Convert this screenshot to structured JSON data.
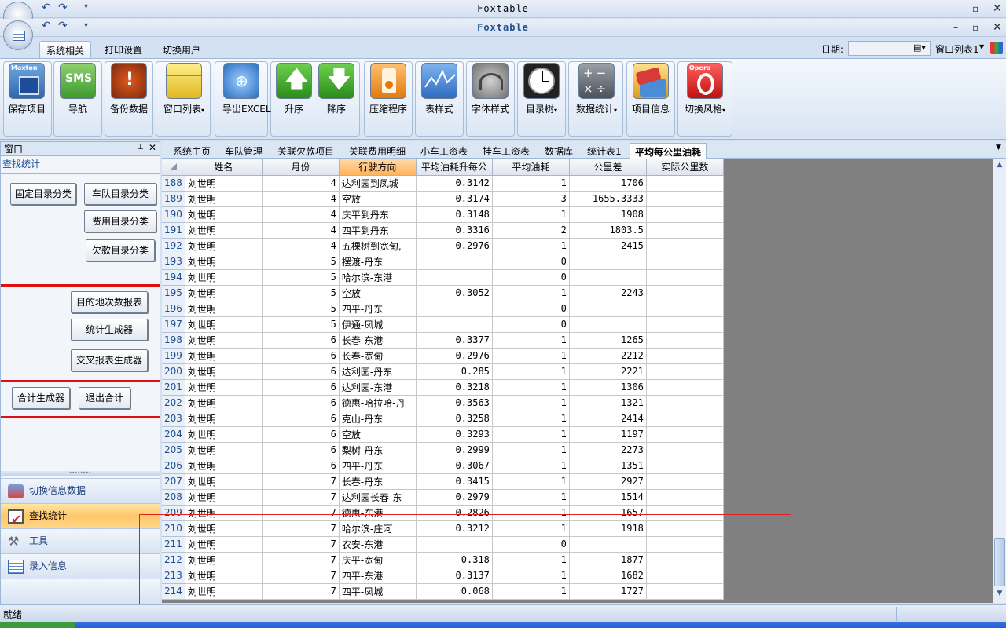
{
  "window": {
    "title": "Foxtable",
    "title2": "Foxtable"
  },
  "ribbon_tabs": [
    "系统相关",
    "打印设置",
    "切换用户"
  ],
  "date": {
    "label": "日期:",
    "value": ""
  },
  "window_list": "窗口列表1",
  "ribbon_buttons": [
    {
      "label": "保存项目",
      "icon": "save-icon"
    },
    {
      "label": "导航",
      "icon": "sms-icon"
    },
    {
      "label": "备份数据",
      "icon": "backup-icon"
    },
    {
      "label": "窗口列表",
      "icon": "window-list-icon",
      "dropdown": true
    },
    {
      "label": "导出EXCEL",
      "icon": "export-icon"
    },
    {
      "label": "升序",
      "icon": "arrow-up-icon"
    },
    {
      "label": "降序",
      "icon": "arrow-down-icon"
    },
    {
      "label": "压缩程序",
      "icon": "compress-icon"
    },
    {
      "label": "表样式",
      "icon": "chart-style-icon"
    },
    {
      "label": "字体样式",
      "icon": "font-style-icon"
    },
    {
      "label": "目录树",
      "icon": "clock-icon",
      "dropdown": true
    },
    {
      "label": "数据统计",
      "icon": "calculator-icon",
      "dropdown": true
    },
    {
      "label": "项目信息",
      "icon": "card-icon"
    },
    {
      "label": "切换风格",
      "icon": "opera-icon",
      "dropdown": true
    }
  ],
  "left_pane": {
    "title": "窗口",
    "subtitle": "查找统计",
    "buttons": [
      "固定目录分类",
      "车队目录分类",
      "费用目录分类",
      "欠款目录分类",
      "目的地次数报表",
      "统计生成器",
      "交叉报表生成器",
      "合计生成器",
      "退出合计"
    ],
    "nav": [
      "切换信息数据",
      "查找统计",
      "工具",
      "录入信息"
    ]
  },
  "doc_tabs": [
    "系统主页",
    "车队管理",
    "关联欠款项目",
    "关联费用明细",
    "小车工资表",
    "挂车工资表",
    "数据库",
    "统计表1",
    "平均每公里油耗"
  ],
  "columns": [
    "姓名",
    "月份",
    "行驶方向",
    "平均油耗升每公",
    "平均油耗",
    "公里差",
    "实际公里数"
  ],
  "rows": [
    [
      "188",
      "刘世明",
      "4",
      "达利园到凤城",
      "0.3142",
      "1",
      "1706",
      ""
    ],
    [
      "189",
      "刘世明",
      "4",
      "空放",
      "0.3174",
      "3",
      "1655.3333",
      ""
    ],
    [
      "190",
      "刘世明",
      "4",
      "庆平到丹东",
      "0.3148",
      "1",
      "1908",
      ""
    ],
    [
      "191",
      "刘世明",
      "4",
      "四平到丹东",
      "0.3316",
      "2",
      "1803.5",
      ""
    ],
    [
      "192",
      "刘世明",
      "4",
      "五棵树到宽甸,",
      "0.2976",
      "1",
      "2415",
      ""
    ],
    [
      "193",
      "刘世明",
      "5",
      "摆渡-丹东",
      "",
      "0",
      "",
      ""
    ],
    [
      "194",
      "刘世明",
      "5",
      "哈尔滨-东港",
      "",
      "0",
      "",
      ""
    ],
    [
      "195",
      "刘世明",
      "5",
      "空放",
      "0.3052",
      "1",
      "2243",
      ""
    ],
    [
      "196",
      "刘世明",
      "5",
      "四平-丹东",
      "",
      "0",
      "",
      ""
    ],
    [
      "197",
      "刘世明",
      "5",
      "伊通-凤城",
      "",
      "0",
      "",
      ""
    ],
    [
      "198",
      "刘世明",
      "6",
      "长春-东港",
      "0.3377",
      "1",
      "1265",
      ""
    ],
    [
      "199",
      "刘世明",
      "6",
      "长春-宽甸",
      "0.2976",
      "1",
      "2212",
      ""
    ],
    [
      "200",
      "刘世明",
      "6",
      "达利园-丹东",
      "0.285",
      "1",
      "2221",
      ""
    ],
    [
      "201",
      "刘世明",
      "6",
      "达利园-东港",
      "0.3218",
      "1",
      "1306",
      ""
    ],
    [
      "202",
      "刘世明",
      "6",
      "德惠-哈拉哈-丹",
      "0.3563",
      "1",
      "1321",
      ""
    ],
    [
      "203",
      "刘世明",
      "6",
      "克山-丹东",
      "0.3258",
      "1",
      "2414",
      ""
    ],
    [
      "204",
      "刘世明",
      "6",
      "空放",
      "0.3293",
      "1",
      "1197",
      ""
    ],
    [
      "205",
      "刘世明",
      "6",
      "梨树-丹东",
      "0.2999",
      "1",
      "2273",
      ""
    ],
    [
      "206",
      "刘世明",
      "6",
      "四平-丹东",
      "0.3067",
      "1",
      "1351",
      ""
    ],
    [
      "207",
      "刘世明",
      "7",
      "长春-丹东",
      "0.3415",
      "1",
      "2927",
      ""
    ],
    [
      "208",
      "刘世明",
      "7",
      "达利园长春-东",
      "0.2979",
      "1",
      "1514",
      ""
    ],
    [
      "209",
      "刘世明",
      "7",
      "德惠-东港",
      "0.2826",
      "1",
      "1657",
      ""
    ],
    [
      "210",
      "刘世明",
      "7",
      "哈尔滨-庄河",
      "0.3212",
      "1",
      "1918",
      ""
    ],
    [
      "211",
      "刘世明",
      "7",
      "农安-东港",
      "",
      "0",
      "",
      ""
    ],
    [
      "212",
      "刘世明",
      "7",
      "庆平-宽甸",
      "0.318",
      "1",
      "1877",
      ""
    ],
    [
      "213",
      "刘世明",
      "7",
      "四平-东港",
      "0.3137",
      "1",
      "1682",
      ""
    ],
    [
      "214",
      "刘世明",
      "7",
      "四平-凤城",
      "0.068",
      "1",
      "1727",
      ""
    ]
  ],
  "status": "就绪"
}
